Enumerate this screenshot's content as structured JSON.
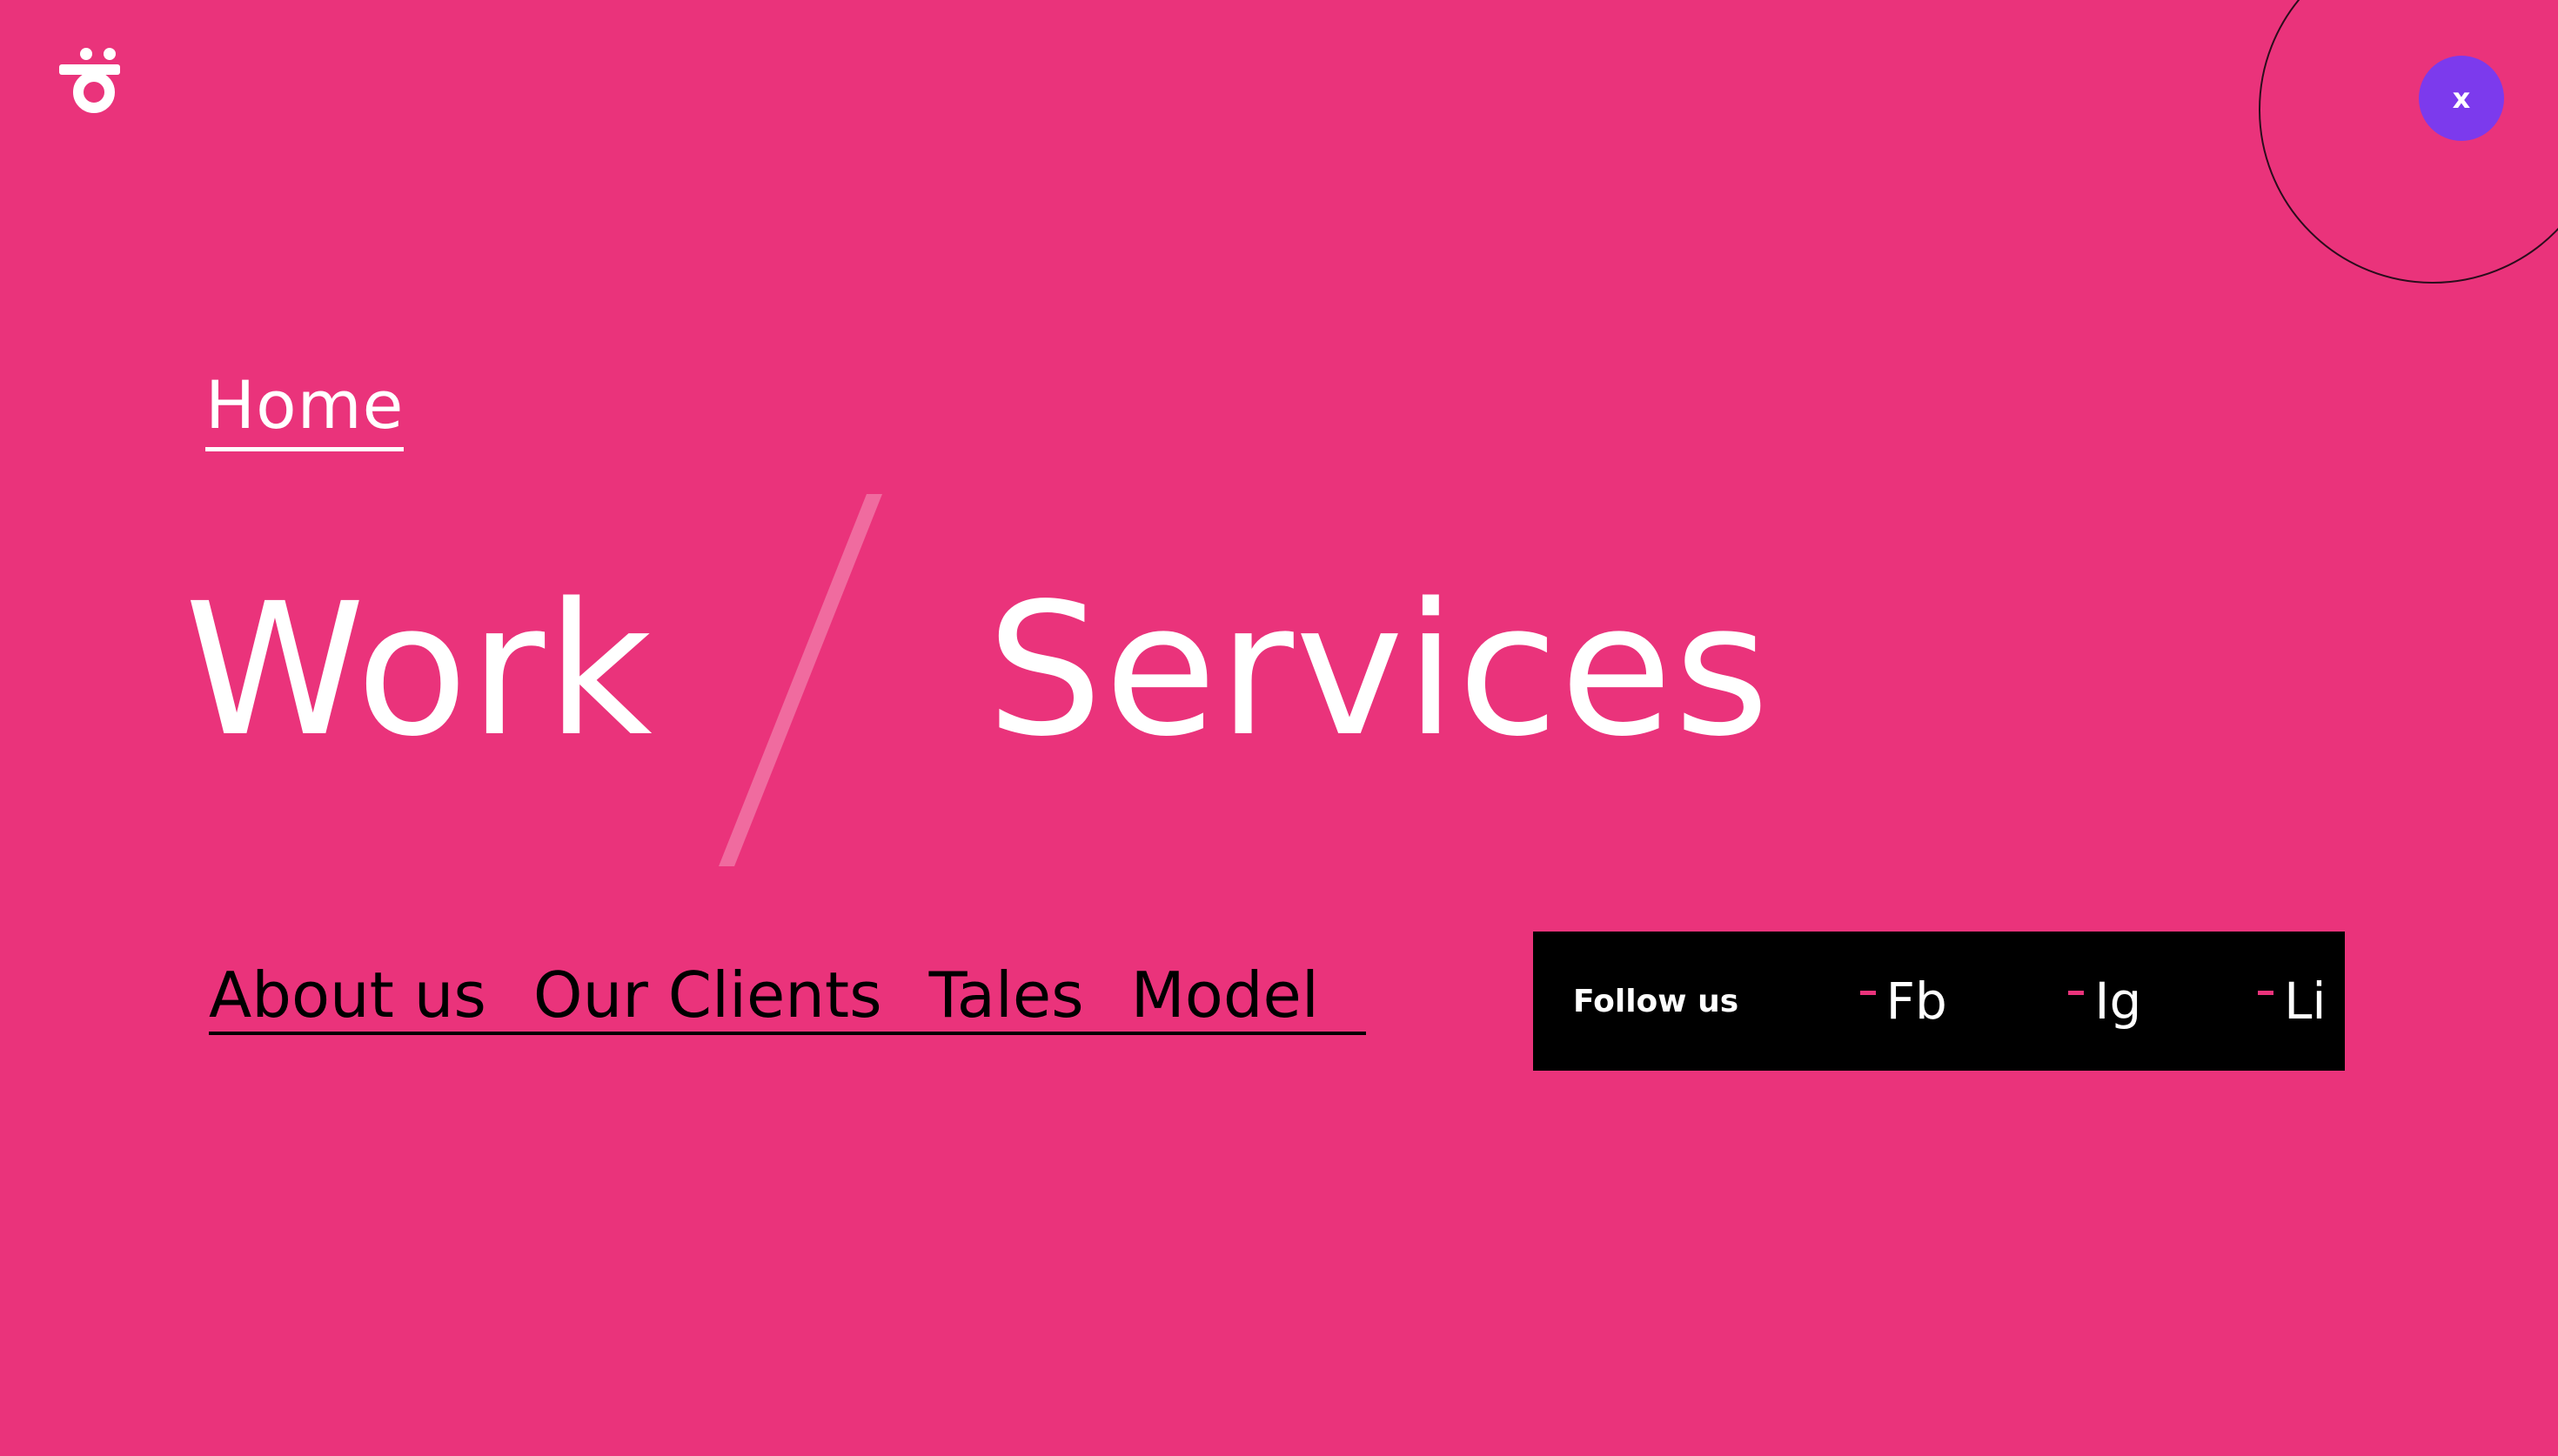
{
  "colors": {
    "background": "#EA337B",
    "close_button": "#7C3AED",
    "follow_bar": "#000000",
    "text_light": "#ffffff",
    "text_dark": "#000000"
  },
  "logo": {
    "icon": "brand-logo-icon"
  },
  "close_button": {
    "label": "x",
    "icon": "close-icon"
  },
  "nav": {
    "home": "Home",
    "work": "Work",
    "services": "Services"
  },
  "sub_nav": {
    "items": [
      "About us",
      "Our Clients",
      "Tales",
      "Model"
    ]
  },
  "social": {
    "follow_label": "Follow us",
    "links": [
      "Fb",
      "Ig",
      "Li"
    ]
  }
}
